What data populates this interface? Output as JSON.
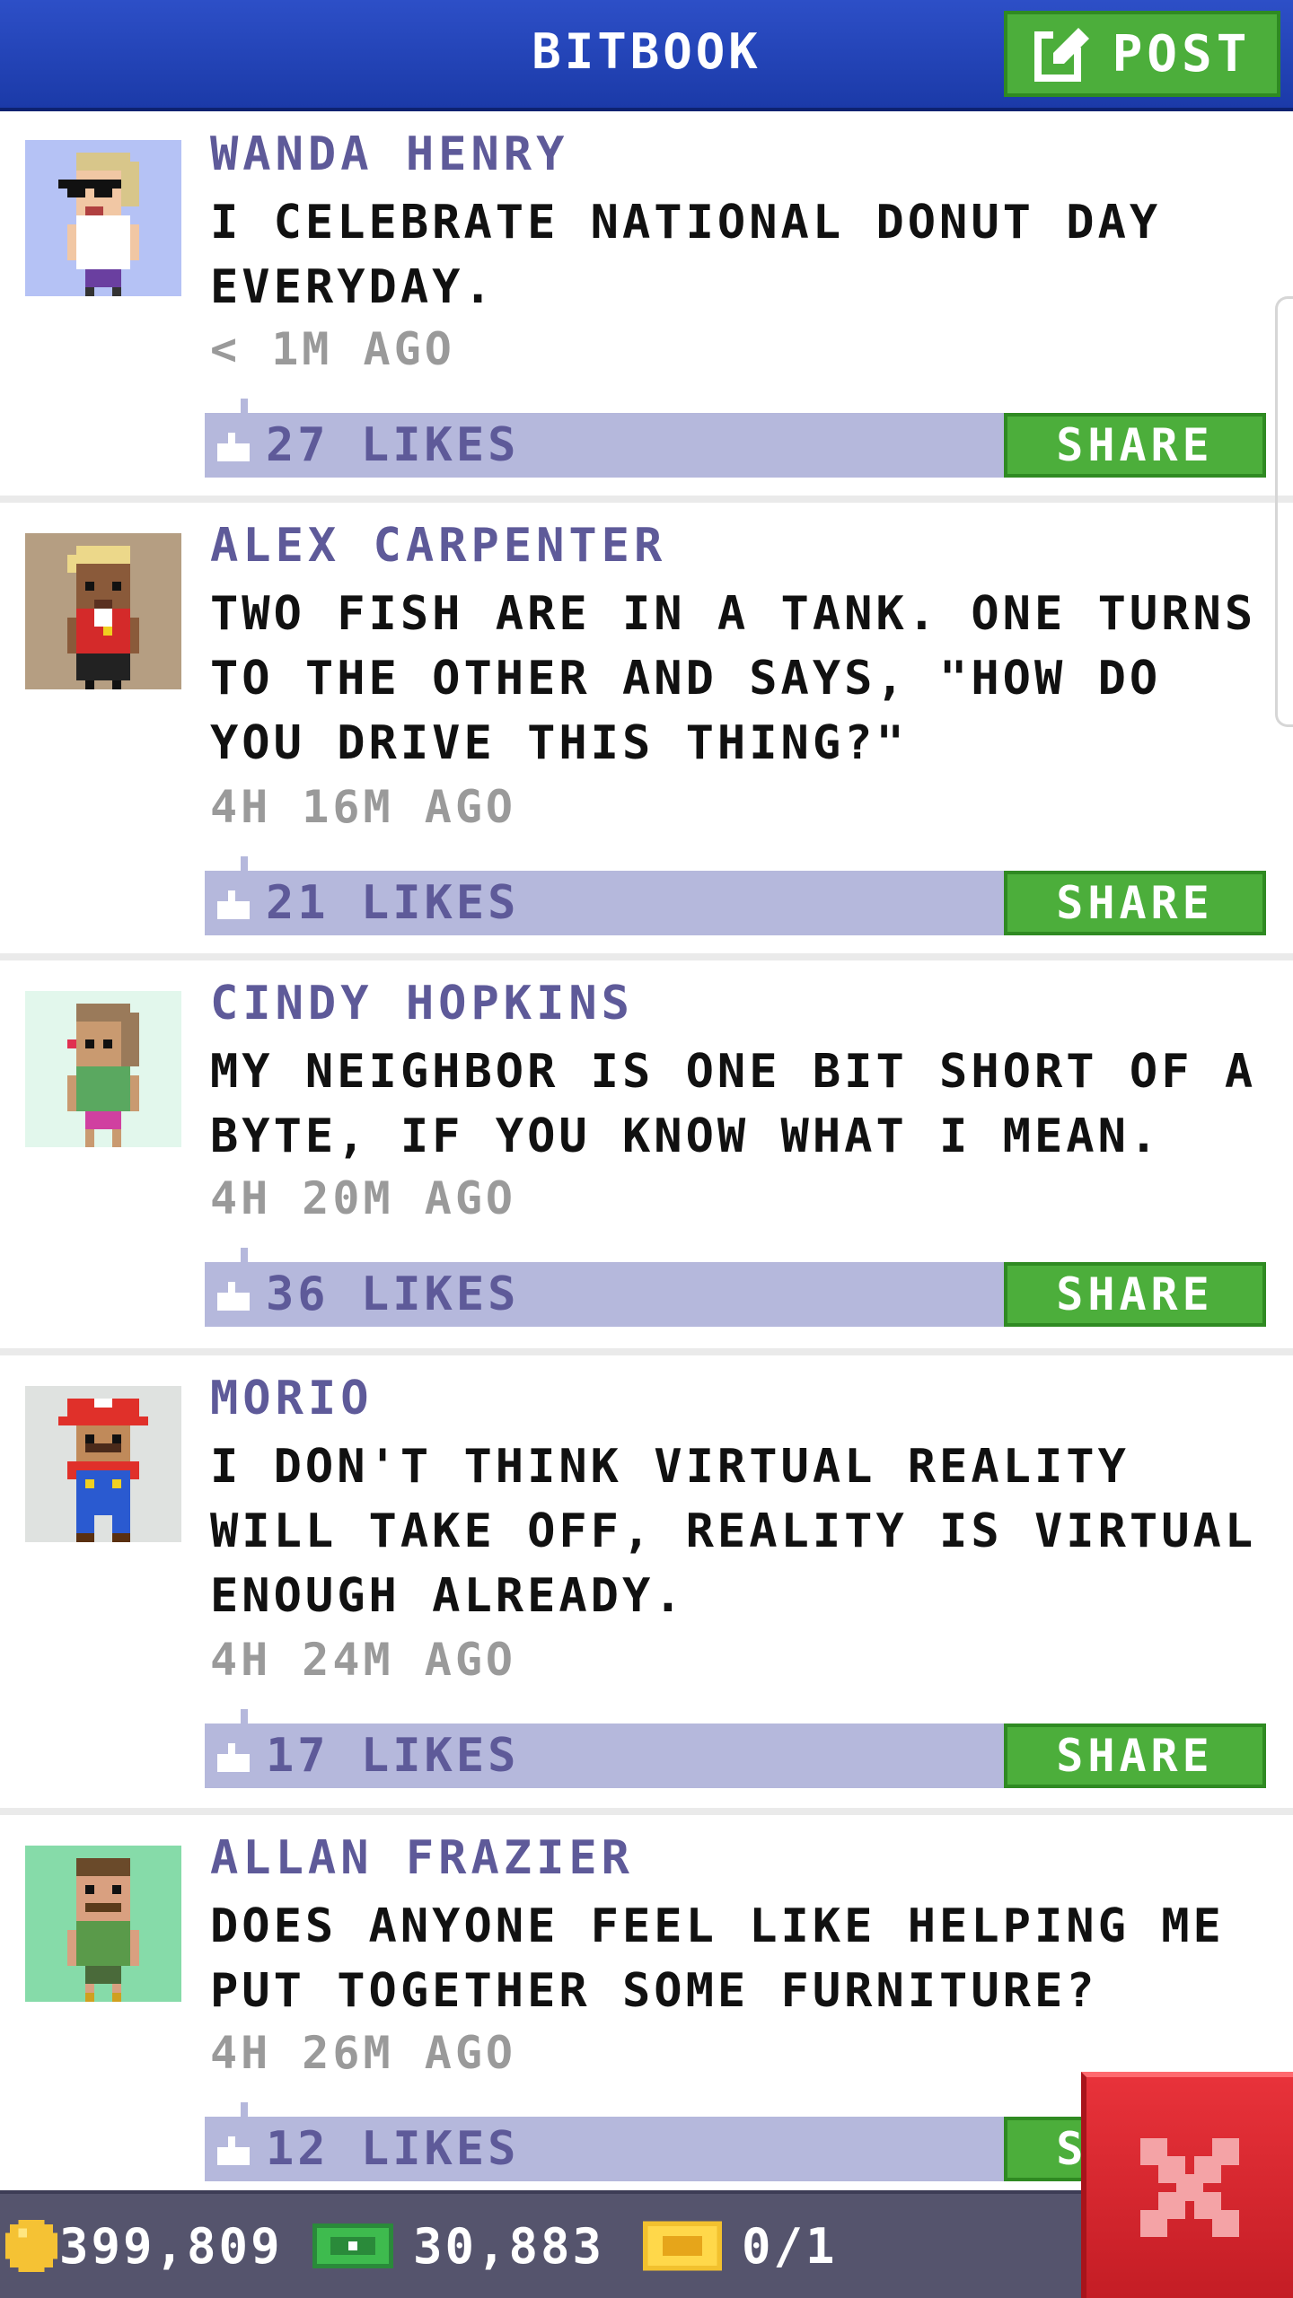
{
  "header": {
    "title": "BITBOOK",
    "post_label": "POST"
  },
  "posts": [
    {
      "author": "WANDA HENRY",
      "message": "I CELEBRATE NATIONAL DONUT DAY EVERYDAY.",
      "time": "< 1M AGO",
      "likes": "27 LIKES",
      "share": "SHARE",
      "avatar_bg": "#b5c2f5"
    },
    {
      "author": "ALEX CARPENTER",
      "message": "TWO FISH ARE IN A TANK. ONE TURNS TO THE OTHER AND SAYS, \"HOW DO YOU DRIVE THIS THING?\"",
      "time": "4H 16M AGO",
      "likes": "21 LIKES",
      "share": "SHARE",
      "avatar_bg": "#b59e82"
    },
    {
      "author": "CINDY HOPKINS",
      "message": "MY NEIGHBOR IS ONE BIT SHORT OF A BYTE, IF YOU KNOW WHAT I MEAN.",
      "time": "4H 20M AGO",
      "likes": "36 LIKES",
      "share": "SHARE",
      "avatar_bg": "#e2f7ec"
    },
    {
      "author": "MORIO",
      "message": "I DON'T THINK VIRTUAL REALITY WILL TAKE OFF, REALITY IS VIRTUAL ENOUGH ALREADY.",
      "time": "4H 24M AGO",
      "likes": "17 LIKES",
      "share": "SHARE",
      "avatar_bg": "#dfe2e0"
    },
    {
      "author": "ALLAN FRAZIER",
      "message": "DOES ANYONE FEEL LIKE HELPING ME PUT TOGETHER SOME FURNITURE?",
      "time": "4H 26M AGO",
      "likes": "12 LIKES",
      "share": "SHARE",
      "avatar_bg": "#86dba9"
    }
  ],
  "footer": {
    "coins": "399,809",
    "bux": "30,883",
    "tickets": "0/1"
  },
  "colors": {
    "header_blue": "#2d4fc7",
    "accent_green": "#4cae3b",
    "likes_bar": "#b5b8dc",
    "author_purple": "#5e5a99",
    "close_red": "#e8323a"
  },
  "icons": {
    "post": "compose-icon",
    "like": "thumbs-up-icon",
    "coins": "coin-icon",
    "bux": "bux-icon",
    "tickets": "ticket-icon",
    "close": "close-icon"
  }
}
